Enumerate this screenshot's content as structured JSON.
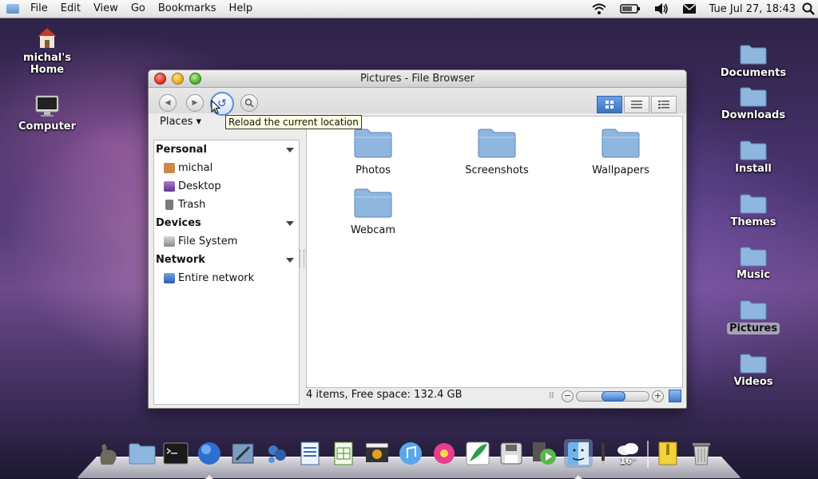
{
  "menubar": {
    "items": [
      "File",
      "Edit",
      "View",
      "Go",
      "Bookmarks",
      "Help"
    ],
    "tray_icons": [
      "wifi-icon",
      "battery-icon",
      "volume-icon",
      "mail-icon",
      "search-icon"
    ],
    "clock": "Tue Jul 27, 18:43"
  },
  "desktop_left": [
    {
      "label": "michal's\nHome",
      "icon": "home-icon"
    },
    {
      "label": "Computer",
      "icon": "computer-icon"
    }
  ],
  "desktop_right": [
    {
      "label": "Documents",
      "selected": false
    },
    {
      "label": "Downloads",
      "selected": false
    },
    {
      "label": "Install",
      "selected": false
    },
    {
      "label": "Themes",
      "selected": false
    },
    {
      "label": "Music",
      "selected": false
    },
    {
      "label": "Pictures",
      "selected": true
    },
    {
      "label": "Videos",
      "selected": false
    }
  ],
  "window": {
    "title": "Pictures - File Browser",
    "tooltip": "Reload the current location",
    "places_label": "Places",
    "sidebar": [
      {
        "header": "Personal",
        "items": [
          {
            "label": "michal",
            "icon": "home-icon",
            "color": "#c98a4a"
          },
          {
            "label": "Desktop",
            "icon": "desktop-icon",
            "color": "#8a5aa8"
          },
          {
            "label": "Trash",
            "icon": "trash-icon",
            "color": "#7a7a7a"
          }
        ]
      },
      {
        "header": "Devices",
        "items": [
          {
            "label": "File System",
            "icon": "drive-icon",
            "color": "#9a9a9a"
          }
        ]
      },
      {
        "header": "Network",
        "items": [
          {
            "label": "Entire network",
            "icon": "network-icon",
            "color": "#3f79c9"
          }
        ]
      }
    ],
    "files": [
      "Photos",
      "Screenshots",
      "Wallpapers",
      "Webcam"
    ],
    "status": "4 items, Free space: 132.4 GB",
    "zoom_level": 0.5
  },
  "dock": {
    "items": [
      "gimp-icon",
      "folder-icon",
      "terminal-icon",
      "browser-icon",
      "mail-app-icon",
      "chat-icon",
      "writer-icon",
      "calc-icon",
      "video-editor-icon",
      "music-icon",
      "photo-app-icon",
      "feather-icon",
      "save-icon",
      "media-player-icon",
      "finder-icon",
      "pencil-icon",
      "weather-icon",
      "archive-icon",
      "trash-icon"
    ],
    "weather_temp": "16°"
  },
  "colors": {
    "folder": "#8fb6de",
    "accent": "#3f79c9"
  }
}
